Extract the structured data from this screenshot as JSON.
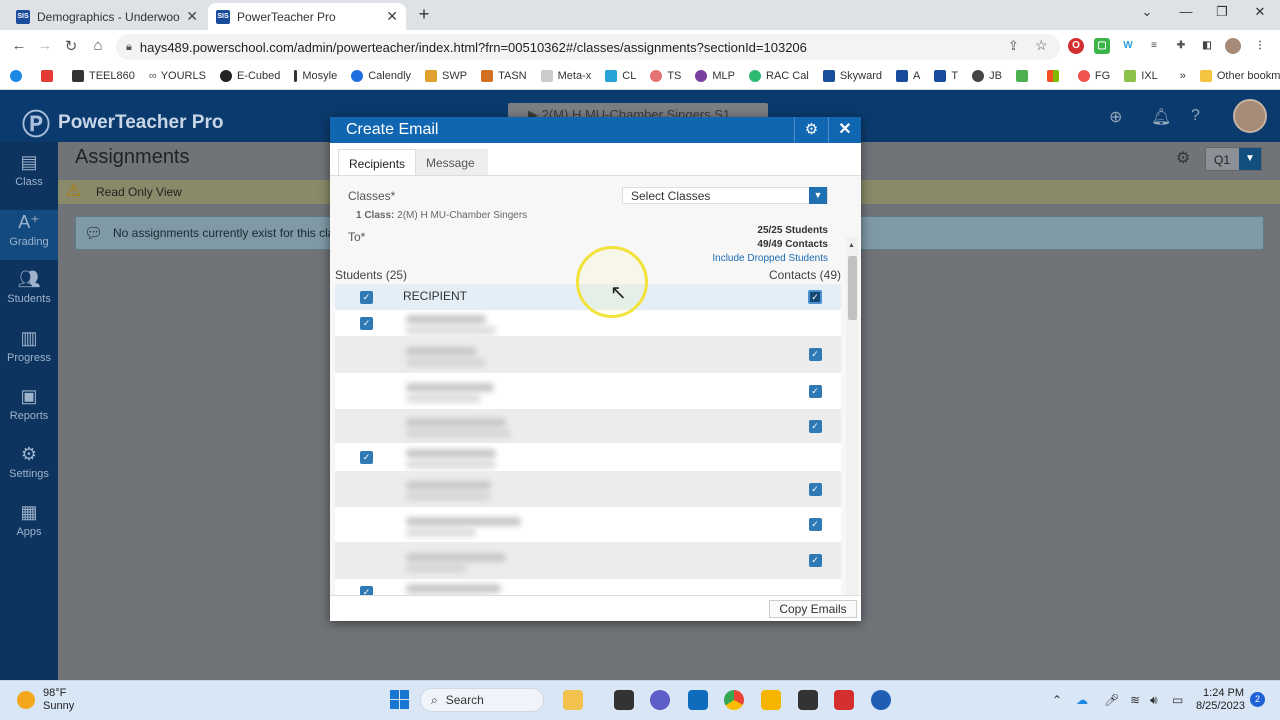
{
  "browser": {
    "tabs": [
      {
        "title": "Demographics - Underwood, Ale",
        "active": false
      },
      {
        "title": "PowerTeacher Pro",
        "active": true
      }
    ],
    "url": "hays489.powerschool.com/admin/powerteacher/index.html?frn=00510362#/classes/assignments?sectionId=103206",
    "bookmarks": [
      "TEEL860",
      "YOURLS",
      "E-Cubed",
      "Mosyle",
      "Calendly",
      "SWP",
      "TASN",
      "Meta-x",
      "CL",
      "TS",
      "MLP",
      "RAC Cal",
      "Skyward",
      "A",
      "T",
      "JB",
      "",
      "",
      "FG",
      "IXL"
    ],
    "more_bookmarks": "»",
    "other_bookmarks": "Other bookmarks"
  },
  "app": {
    "brand": "PowerTeacher Pro",
    "page_title": "Assignments",
    "read_only": "Read Only View",
    "no_assignments": "No assignments currently exist for this cla",
    "top_class_selector": "▶  2(M) H MU-Chamber Singers   S1",
    "term": "Q1",
    "sidebar": [
      {
        "label": "Class",
        "icon": "class-icon"
      },
      {
        "label": "Grading",
        "icon": "grading-icon"
      },
      {
        "label": "Students",
        "icon": "students-icon"
      },
      {
        "label": "Progress",
        "icon": "progress-icon"
      },
      {
        "label": "Reports",
        "icon": "reports-icon"
      },
      {
        "label": "Settings",
        "icon": "settings-icon"
      },
      {
        "label": "Apps",
        "icon": "apps-icon"
      }
    ]
  },
  "modal": {
    "title": "Create Email",
    "tabs": [
      "Recipients",
      "Message"
    ],
    "classes_label": "Classes*",
    "select_classes": "Select Classes",
    "one_class_prefix": "1 Class:",
    "one_class_name": "2(M) H MU-Chamber Singers",
    "to_label": "To*",
    "students_count": "25/25 Students",
    "contacts_count": "49/49 Contacts",
    "include_dropped": "Include Dropped Students",
    "students_header": "Students (25)",
    "contacts_header": "Contacts (49)",
    "recipient_header": "RECIPIENT",
    "rows": [
      {
        "student": true,
        "contact": false
      },
      {
        "student": false,
        "contact": true
      },
      {
        "student": false,
        "contact": true
      },
      {
        "student": false,
        "contact": true
      },
      {
        "student": true,
        "contact": false
      },
      {
        "student": false,
        "contact": true
      },
      {
        "student": false,
        "contact": true
      },
      {
        "student": false,
        "contact": true
      },
      {
        "student": true,
        "contact": false
      }
    ],
    "copy_emails": "Copy Emails"
  },
  "taskbar": {
    "temp": "98°F",
    "condition": "Sunny",
    "search": "Search",
    "time": "1:24 PM",
    "date": "8/25/2023",
    "notifications": "2"
  }
}
